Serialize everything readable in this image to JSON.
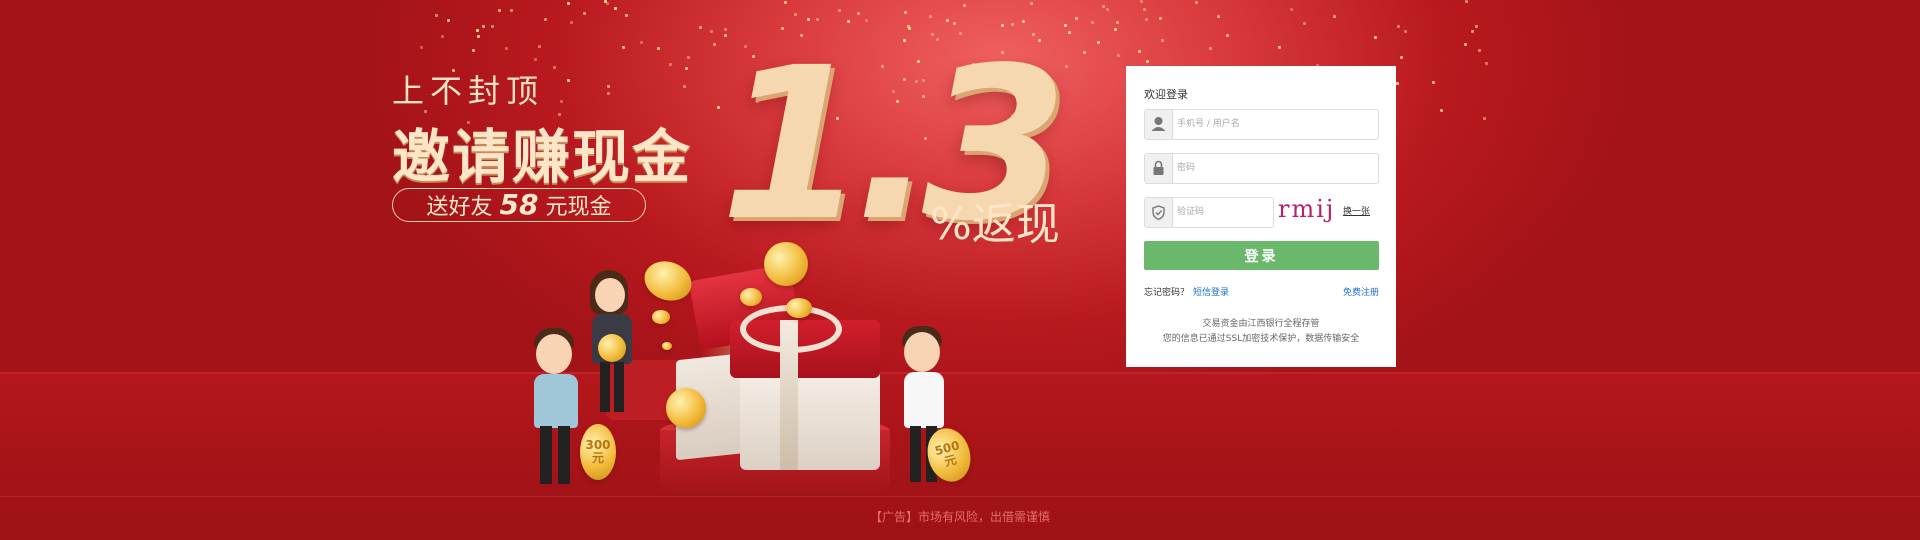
{
  "promo": {
    "line1": "上不封顶",
    "line2": "邀请赚现金",
    "pill_prefix": "送好友",
    "pill_amount": "58",
    "pill_suffix": "元现金",
    "big_number": "1.3",
    "percent_text": "%返现",
    "coin_left_amount": "300",
    "coin_left_unit": "元",
    "coin_right_amount": "500",
    "coin_right_unit": "元"
  },
  "login": {
    "title": "欢迎登录",
    "username_placeholder": "手机号 / 用户名",
    "password_placeholder": "密码",
    "captcha_placeholder": "验证码",
    "captcha_text": "rmij",
    "swap_label": "换一张",
    "submit_label": "登录",
    "forgot_label": "忘记密码？",
    "sms_label": "短信登录",
    "register_label": "免费注册",
    "notice_1": "交易资金由江西银行全程存管",
    "notice_2": "您的信息已通过SSL加密技术保护，数据传输安全"
  },
  "footer": {
    "disclaimer": "【广告】市场有风险，出借需谨慎"
  },
  "colors": {
    "background": "#c21d22",
    "gold": "#f6d8b0",
    "login_button": "#6ab86c",
    "link": "#1f6fd1"
  },
  "icons": {
    "username": "user-icon",
    "password": "lock-icon",
    "captcha": "shield-icon"
  }
}
